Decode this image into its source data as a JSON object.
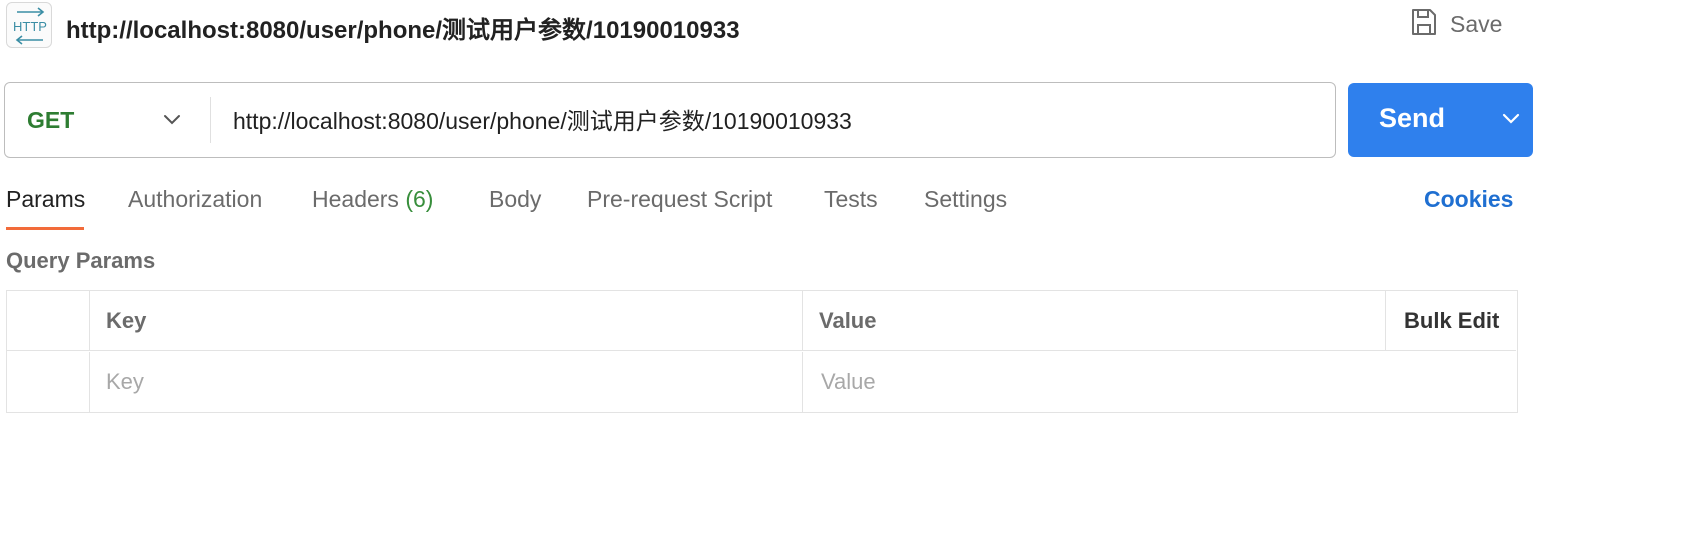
{
  "header": {
    "icon_text": "HTTP",
    "title": "http://localhost:8080/user/phone/测试用户参数/10190010933",
    "save_label": "Save"
  },
  "request": {
    "method": "GET",
    "url": "http://localhost:8080/user/phone/测试用户参数/10190010933",
    "send_label": "Send"
  },
  "tabs": {
    "params": "Params",
    "authorization": "Authorization",
    "headers": "Headers",
    "headers_count": "(6)",
    "body": "Body",
    "prerequest": "Pre-request Script",
    "tests": "Tests",
    "settings": "Settings",
    "cookies": "Cookies",
    "active": "Params"
  },
  "query_params": {
    "section_label": "Query Params",
    "columns": {
      "key": "Key",
      "value": "Value",
      "bulk_edit": "Bulk Edit"
    },
    "new_row": {
      "key_placeholder": "Key",
      "value_placeholder": "Value"
    }
  },
  "colors": {
    "method": "#2e7d32",
    "send": "#2f80ed",
    "active_tab_underline": "#f26b3a",
    "cookies_link": "#1f6fd1",
    "headers_count": "#388e3c"
  }
}
